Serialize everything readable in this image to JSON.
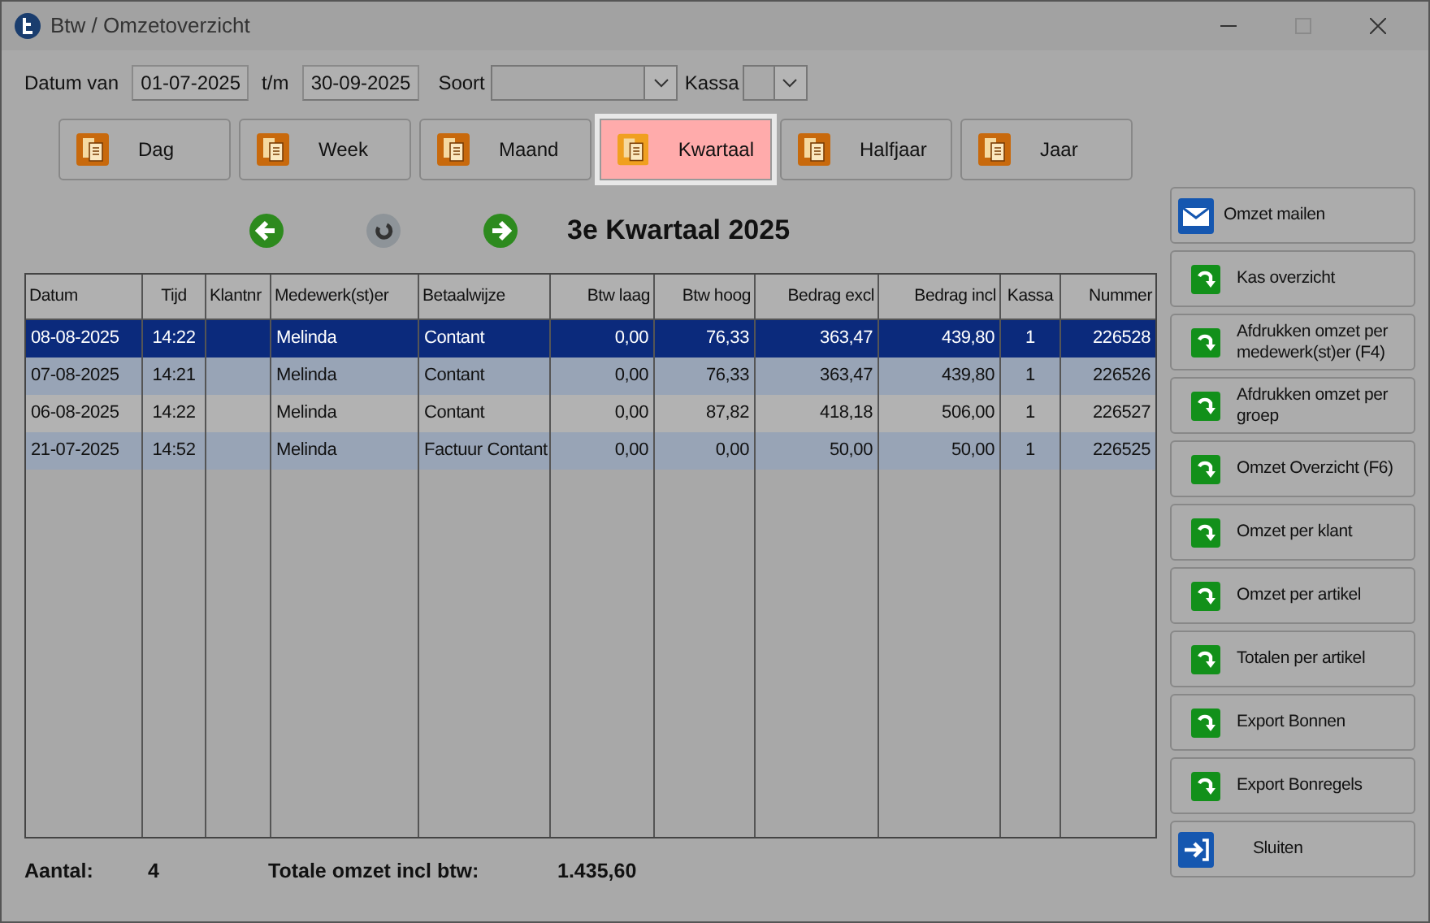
{
  "window": {
    "title": "Btw / Omzetoverzicht"
  },
  "filters": {
    "date_from_label": "Datum van",
    "date_from": "01-07-2025",
    "date_to_label": "t/m",
    "date_to": "30-09-2025",
    "type_label": "Soort",
    "register_label": "Kassa"
  },
  "periods": [
    {
      "label": "Dag",
      "selected": false
    },
    {
      "label": "Week",
      "selected": false
    },
    {
      "label": "Maand",
      "selected": false
    },
    {
      "label": "Kwartaal",
      "selected": true
    },
    {
      "label": "Halfjaar",
      "selected": false
    },
    {
      "label": "Jaar",
      "selected": false
    }
  ],
  "period_title": "3e Kwartaal 2025",
  "table": {
    "columns": [
      "Datum",
      "Tijd",
      "Klantnr",
      "Medewerk(st)er",
      "Betaalwijze",
      "Btw laag",
      "Btw hoog",
      "Bedrag excl",
      "Bedrag incl",
      "Kassa",
      "Nummer"
    ],
    "rows": [
      {
        "selected": true,
        "cells": [
          "08-08-2025",
          "14:22",
          "",
          "Melinda",
          "Contant",
          "0,00",
          "76,33",
          "363,47",
          "439,80",
          "1",
          "226528"
        ]
      },
      {
        "selected": false,
        "cells": [
          "07-08-2025",
          "14:21",
          "",
          "Melinda",
          "Contant",
          "0,00",
          "76,33",
          "363,47",
          "439,80",
          "1",
          "226526"
        ]
      },
      {
        "selected": false,
        "cells": [
          "06-08-2025",
          "14:22",
          "",
          "Melinda",
          "Contant",
          "0,00",
          "87,82",
          "418,18",
          "506,00",
          "1",
          "226527"
        ]
      },
      {
        "selected": false,
        "cells": [
          "21-07-2025",
          "14:52",
          "",
          "Melinda",
          "Factuur Contant",
          "0,00",
          "0,00",
          "50,00",
          "50,00",
          "1",
          "226525"
        ]
      }
    ]
  },
  "actions": [
    {
      "kind": "mail",
      "label": "Omzet mailen"
    },
    {
      "kind": "print",
      "label": "Kas overzicht"
    },
    {
      "kind": "print",
      "label": "Afdrukken omzet per medewerk(st)er (F4)"
    },
    {
      "kind": "print",
      "label": "Afdrukken omzet per groep"
    },
    {
      "kind": "print",
      "label": "Omzet Overzicht (F6)"
    },
    {
      "kind": "print",
      "label": "Omzet per klant"
    },
    {
      "kind": "print",
      "label": "Omzet per artikel"
    },
    {
      "kind": "print",
      "label": "Totalen per artikel"
    },
    {
      "kind": "print",
      "label": "Export Bonnen"
    },
    {
      "kind": "print",
      "label": "Export Bonregels"
    },
    {
      "kind": "exit",
      "label": "Sluiten"
    }
  ],
  "footer": {
    "count_label": "Aantal:",
    "count": "4",
    "total_label": "Totale omzet incl btw:",
    "total": "1.435,60"
  }
}
